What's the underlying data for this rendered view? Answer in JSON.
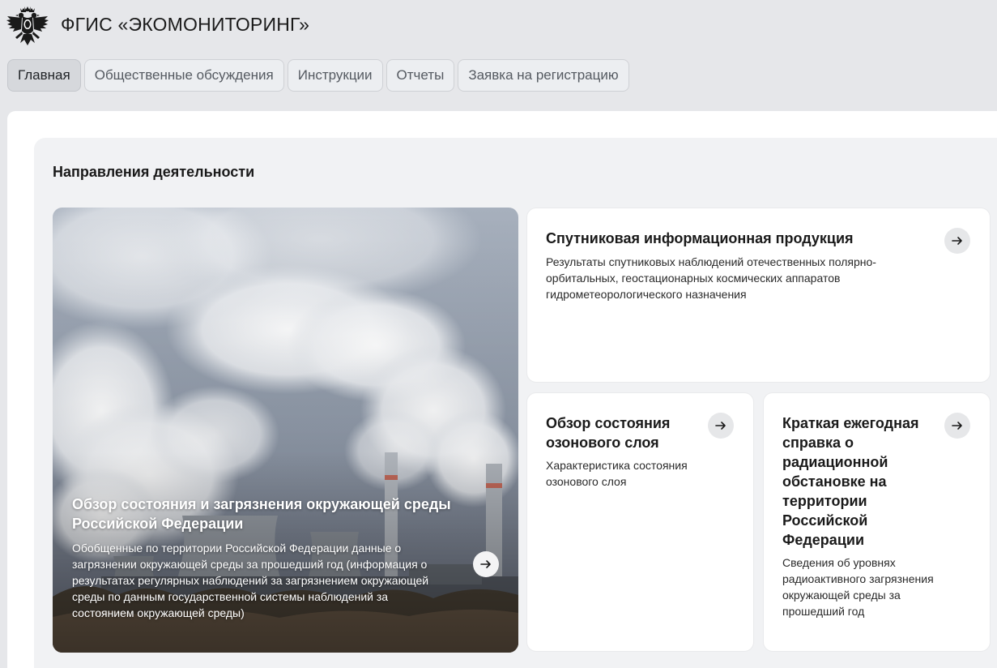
{
  "header": {
    "title": "ФГИС «ЭКОМОНИТОРИНГ»",
    "logo_icon": "double-headed-eagle-emblem"
  },
  "nav": {
    "tabs": [
      {
        "label": "Главная",
        "active": true
      },
      {
        "label": "Общественные обсуждения",
        "active": false
      },
      {
        "label": "Инструкции",
        "active": false
      },
      {
        "label": "Отчеты",
        "active": false
      },
      {
        "label": "Заявка на регистрацию",
        "active": false
      }
    ]
  },
  "section": {
    "title": "Направления деятельности"
  },
  "hero": {
    "title": "Обзор состояния и загрязнения окружающей среды Российской Федерации",
    "description": "Обобщенные по территории Российской Федерации данные о загрязнении окружающей среды за прошедший год (информация о результатах регулярных наблюдений за загрязнением окружающей среды по данным государственной системы наблюдений за состоянием окружающей среды)",
    "arrow_icon": "arrow-right-icon"
  },
  "cards": [
    {
      "title": "Спутниковая информационная продукция",
      "description": "Результаты спутниковых наблюдений отечественных полярно-орбитальных, геостационарных космических аппаратов гидрометеорологического назначения",
      "arrow_icon": "arrow-right-icon"
    },
    {
      "title": "Обзор состояния озонового слоя",
      "description": "Характеристика состояния озонового слоя",
      "arrow_icon": "arrow-right-icon"
    },
    {
      "title": "Краткая ежегодная справка о радиационной обстановке на территории Российской Федерации",
      "description": "Сведения об уровнях радиоактивного загрязнения окружающей среды за прошедший год",
      "arrow_icon": "arrow-right-icon"
    }
  ],
  "colors": {
    "page_bg": "#e6e7ea",
    "card_bg": "#ffffff",
    "section_bg": "#f1f2f4",
    "active_tab_bg": "#d6d8dc",
    "arrow_button_bg": "#e6e7e9"
  }
}
